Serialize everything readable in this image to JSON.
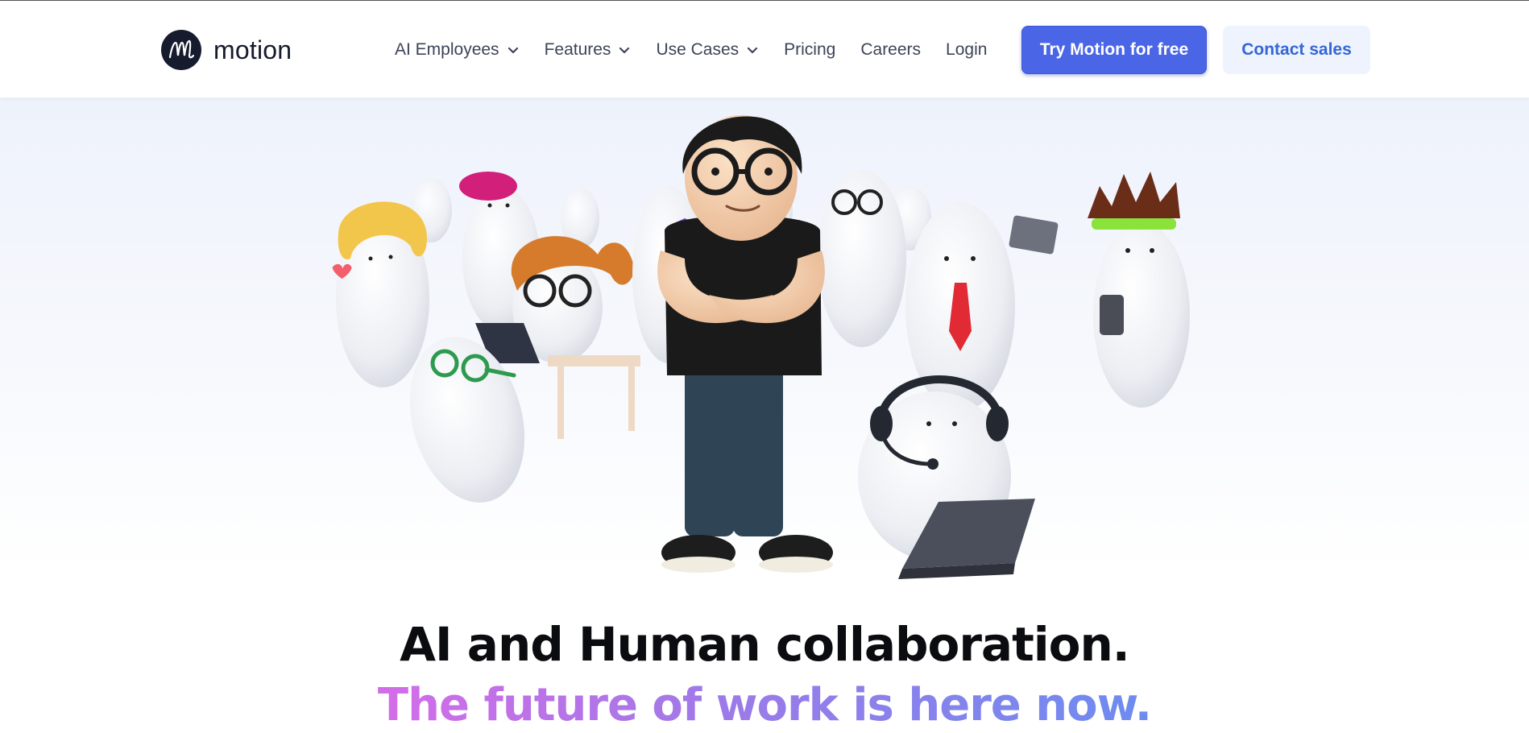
{
  "brand": {
    "name": "motion",
    "logo_icon": "motion-logo-icon"
  },
  "nav": {
    "items": [
      {
        "label": "AI Employees",
        "has_dropdown": true
      },
      {
        "label": "Features",
        "has_dropdown": true
      },
      {
        "label": "Use Cases",
        "has_dropdown": true
      },
      {
        "label": "Pricing",
        "has_dropdown": false
      },
      {
        "label": "Careers",
        "has_dropdown": false
      },
      {
        "label": "Login",
        "has_dropdown": false
      }
    ]
  },
  "cta": {
    "primary_label": "Try Motion for free",
    "secondary_label": "Contact sales"
  },
  "hero": {
    "headline": "AI and Human collaboration.",
    "subheadline": "The future of work is here now."
  },
  "colors": {
    "primary": "#4a66e6",
    "secondary_bg": "#eef3fd",
    "secondary_text": "#3467d6",
    "gradient_start": "#d46ce8",
    "gradient_end": "#6d8cf0"
  }
}
